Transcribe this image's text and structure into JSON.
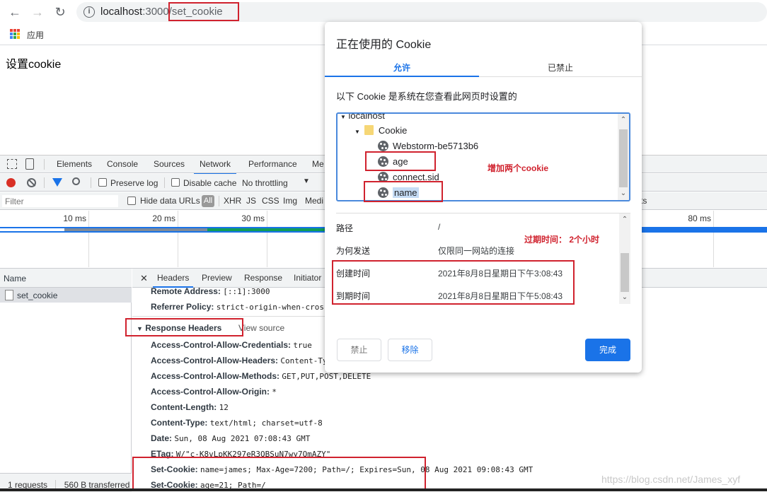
{
  "browser": {
    "url_host": "localhost",
    "url_port": ":3000",
    "url_path": "/set_cookie",
    "bookmark_apps_label": "应用",
    "page_heading": "设置cookie"
  },
  "devtools": {
    "tabs": [
      "Elements",
      "Console",
      "Sources",
      "Network",
      "Performance",
      "Me"
    ],
    "active_tab": "Network",
    "controls": {
      "preserve_log": "Preserve log",
      "disable_cache": "Disable cache",
      "throttling": "No throttling"
    },
    "filter": {
      "placeholder": "Filter",
      "hide_data_urls": "Hide data URLs",
      "types": [
        "All",
        "XHR",
        "JS",
        "CSS",
        "Img",
        "Medi"
      ]
    },
    "timeline_ticks": [
      "10 ms",
      "20 ms",
      "30 ms",
      "80 ms"
    ],
    "requests": {
      "header": "Name",
      "items": [
        "set_cookie"
      ],
      "status_count": "1 requests",
      "status_transferred": "560 B transferred"
    },
    "detail_tabs": [
      "Headers",
      "Preview",
      "Response",
      "Initiator"
    ],
    "general": [
      {
        "key": "Remote Address:",
        "value": "[::1]:3000"
      },
      {
        "key": "Referrer Policy:",
        "value": "strict-origin-when-cros:"
      }
    ],
    "response_headers_title": "Response Headers",
    "view_source": "View source",
    "response_headers": [
      {
        "key": "Access-Control-Allow-Credentials:",
        "value": "true"
      },
      {
        "key": "Access-Control-Allow-Headers:",
        "value": "Content-Ty"
      },
      {
        "key": "Access-Control-Allow-Methods:",
        "value": "GET,PUT,POST,DELETE"
      },
      {
        "key": "Access-Control-Allow-Origin:",
        "value": "*"
      },
      {
        "key": "Content-Length:",
        "value": "12"
      },
      {
        "key": "Content-Type:",
        "value": "text/html; charset=utf-8"
      },
      {
        "key": "Date:",
        "value": "Sun, 08 Aug 2021 07:08:43 GMT"
      },
      {
        "key": "ETag:",
        "value": "W/\"c-K8vLpKK297eR3QBSuN7wy7QmAZY\""
      },
      {
        "key": "Set-Cookie:",
        "value": "name=james; Max-Age=7200; Path=/; Expires=Sun, 08 Aug 2021 09:08:43 GMT"
      },
      {
        "key": "Set-Cookie:",
        "value": "age=21; Path=/"
      }
    ]
  },
  "dialog": {
    "title": "正在使用的 Cookie",
    "tab_allowed": "允许",
    "tab_blocked": "已禁止",
    "description": "以下 Cookie 是系统在您查看此网页时设置的",
    "tree": {
      "site": "localhost",
      "folder": "Cookie",
      "cookies": [
        "Webstorm-be5713b6",
        "age",
        "connect.sid",
        "name"
      ],
      "selected": "name"
    },
    "properties": [
      {
        "key": "路径",
        "value": "/"
      },
      {
        "key": "为何发送",
        "value": "仅限同一网站的连接"
      },
      {
        "key": "创建时间",
        "value": "2021年8月8日星期日下午3:08:43"
      },
      {
        "key": "到期时间",
        "value": "2021年8月8日星期日下午5:08:43"
      }
    ],
    "buttons": {
      "block": "禁止",
      "remove": "移除",
      "done": "完成"
    }
  },
  "annotations": {
    "added_cookies": "增加两个cookie",
    "expiry_note": "过期时间：  2个小时"
  },
  "watermark": "https://blog.csdn.net/James_xyf",
  "colors": {
    "accent": "#1a73e8",
    "annotation": "#d0222e",
    "record": "#d93025"
  }
}
